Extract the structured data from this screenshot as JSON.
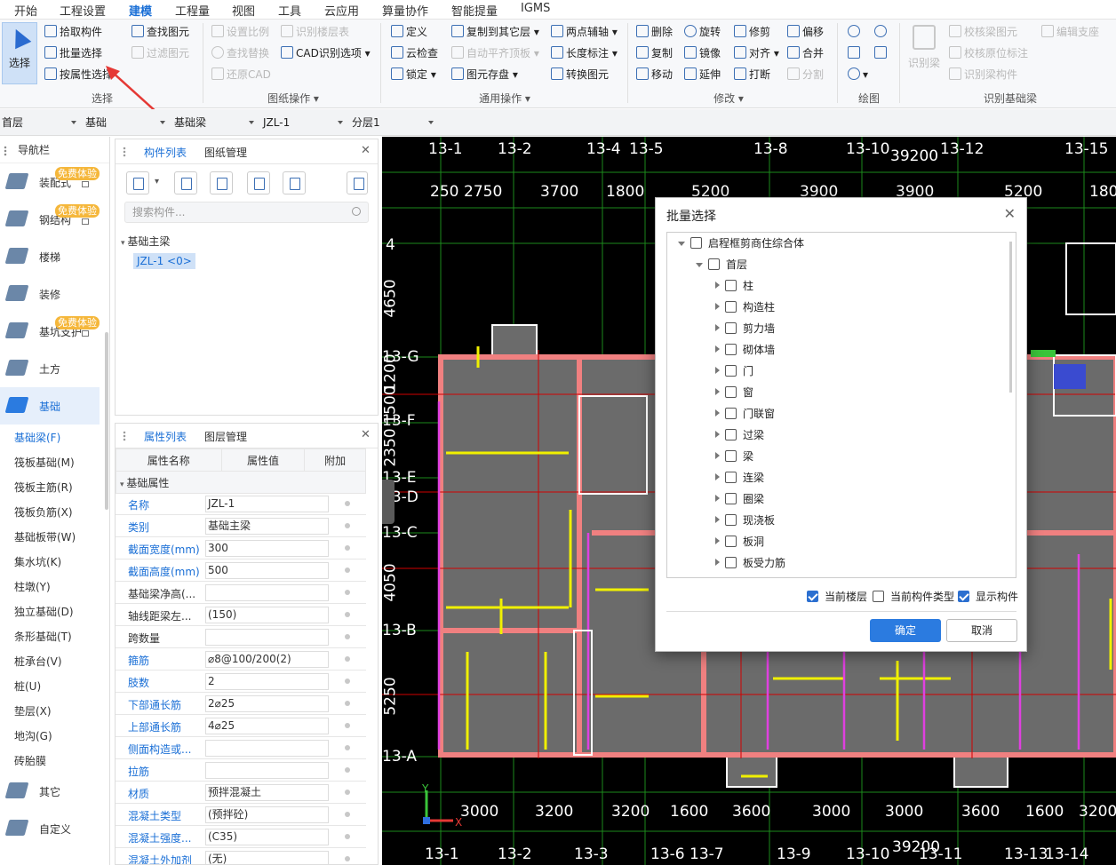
{
  "menu": [
    "开始",
    "工程设置",
    "建模",
    "工程量",
    "视图",
    "工具",
    "云应用",
    "算量协作",
    "智能提量",
    "IGMS"
  ],
  "ribbon": {
    "select_big": "选择",
    "select_items": [
      "拾取构件",
      "批量选择",
      "按属性选择"
    ],
    "find_items": [
      "查找图元",
      "过滤图元"
    ],
    "select_group": "选择",
    "drawing_items": [
      "设置比例",
      "查找替换",
      "还原CAD",
      "识别楼层表",
      "CAD识别选项"
    ],
    "drawing_group": "图纸操作",
    "common_items": [
      "定义",
      "云检查",
      "锁定",
      "复制到其它层",
      "自动平齐顶板",
      "图元存盘",
      "两点辅轴",
      "长度标注",
      "转换图元"
    ],
    "common_group": "通用操作",
    "modify_items": [
      "删除",
      "复制",
      "移动",
      "旋转",
      "镜像",
      "延伸",
      "修剪",
      "对齐",
      "打断",
      "偏移",
      "合并",
      "分割"
    ],
    "modify_group": "修改",
    "draw_group": "绘图",
    "recog_big": "识别梁",
    "recog_items": [
      "校核梁图元",
      "校核原位标注",
      "识别梁构件",
      "编辑支座"
    ],
    "recog_group": "识别基础梁"
  },
  "toolbar2": {
    "floor": "首层",
    "category": "基础",
    "type": "基础梁",
    "component": "JZL-1",
    "layer": "分层1"
  },
  "nav": {
    "title": "导航栏",
    "badge": "免费体验",
    "items": [
      "装配式",
      "钢结构",
      "楼梯",
      "装修",
      "基坑支护",
      "土方",
      "基础"
    ],
    "sub_items": [
      "基础梁(F)",
      "筏板基础(M)",
      "筏板主筋(R)",
      "筏板负筋(X)",
      "基础板带(W)",
      "集水坑(K)",
      "柱墩(Y)",
      "独立基础(D)",
      "条形基础(T)",
      "桩承台(V)",
      "桩(U)",
      "垫层(X)",
      "地沟(G)",
      "砖胎膜"
    ],
    "bottom_items": [
      "其它",
      "自定义"
    ]
  },
  "component_panel": {
    "tabs": [
      "构件列表",
      "图纸管理"
    ],
    "search_placeholder": "搜索构件...",
    "tree_root": "基础主梁",
    "tree_item": "JZL-1 <0>"
  },
  "property_panel": {
    "tabs": [
      "属性列表",
      "图层管理"
    ],
    "headers": [
      "属性名称",
      "属性值",
      "附加"
    ],
    "group": "基础属性",
    "rows": [
      {
        "name": "名称",
        "value": "JZL-1",
        "blue": true
      },
      {
        "name": "类别",
        "value": "基础主梁",
        "blue": true
      },
      {
        "name": "截面宽度(mm)",
        "value": "300",
        "blue": true
      },
      {
        "name": "截面高度(mm)",
        "value": "500",
        "blue": true
      },
      {
        "name": "基础梁净高(...",
        "value": "",
        "blue": false
      },
      {
        "name": "轴线距梁左...",
        "value": "(150)",
        "blue": false
      },
      {
        "name": "跨数量",
        "value": "",
        "blue": false
      },
      {
        "name": "箍筋",
        "value": "⌀8@100/200(2)",
        "blue": true
      },
      {
        "name": "肢数",
        "value": "2",
        "blue": true
      },
      {
        "name": "下部通长筋",
        "value": "2⌀25",
        "blue": true
      },
      {
        "name": "上部通长筋",
        "value": "4⌀25",
        "blue": true
      },
      {
        "name": "侧面构造或...",
        "value": "",
        "blue": true
      },
      {
        "name": "拉筋",
        "value": "",
        "blue": true
      },
      {
        "name": "材质",
        "value": "预拌混凝土",
        "blue": true
      },
      {
        "name": "混凝土类型",
        "value": "(预拌砼)",
        "blue": true
      },
      {
        "name": "混凝土强度...",
        "value": "(C35)",
        "blue": true
      },
      {
        "name": "混凝土外加剂",
        "value": "(无)",
        "blue": true
      }
    ]
  },
  "canvas": {
    "top_axes": [
      "13-1",
      "13-2",
      "13-4",
      "13-5",
      "13-8",
      "13-10",
      "13-12",
      "13-15"
    ],
    "top_dims": [
      "250",
      "2750",
      "3700",
      "1800",
      "5200",
      "3900",
      "3900",
      "5200",
      "180"
    ],
    "top_total": "39200",
    "bottom_dims": [
      "3000",
      "3200",
      "3200",
      "1600",
      "3600",
      "3000",
      "3000",
      "3600",
      "1600",
      "3200"
    ],
    "bottom_total": "39200",
    "bottom_axes": [
      "13-1",
      "13-2",
      "13-3",
      "13-6",
      "13-7",
      "13-9",
      "13-10",
      "13-11",
      "13-13",
      "13-14"
    ],
    "left_axes": [
      "4",
      "13-G",
      "13-F",
      "13-E",
      "13-D",
      "13-C",
      "13-B",
      "13-A"
    ],
    "left_dims": [
      "4650",
      "1200",
      "1500",
      "2350",
      "4050",
      "5250"
    ]
  },
  "dialog": {
    "title": "批量选择",
    "root": "启程框剪商住综合体",
    "floor": "首层",
    "items": [
      "柱",
      "构造柱",
      "剪力墙",
      "砌体墙",
      "门",
      "窗",
      "门联窗",
      "过梁",
      "梁",
      "连梁",
      "圈梁",
      "现浇板",
      "板洞",
      "板受力筋"
    ],
    "opt_current_floor": "当前楼层",
    "opt_current_type": "当前构件类型",
    "opt_show": "显示构件",
    "ok": "确定",
    "cancel": "取消"
  }
}
